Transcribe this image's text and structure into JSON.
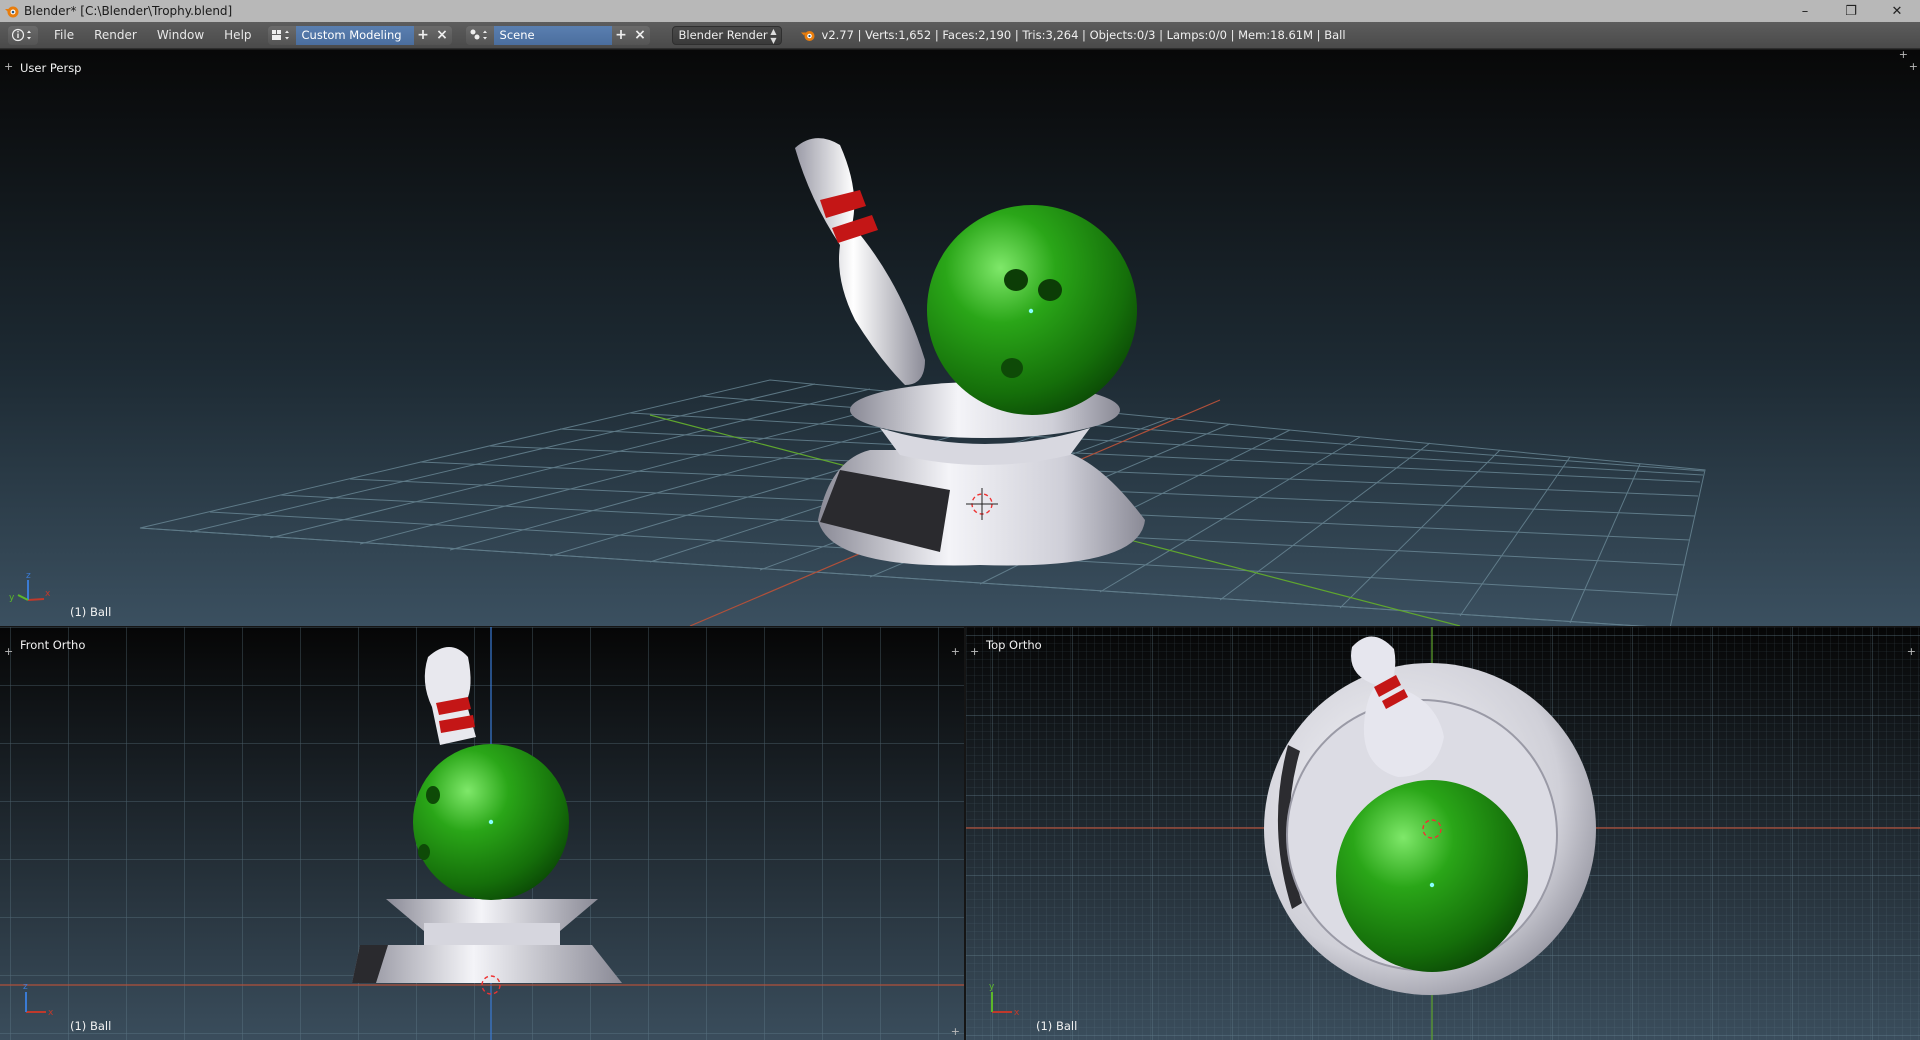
{
  "window": {
    "title": "Blender* [C:\\Blender\\Trophy.blend]",
    "controls": {
      "minimize": "–",
      "restore": "❐",
      "close": "✕"
    }
  },
  "header": {
    "menus": [
      "File",
      "Render",
      "Window",
      "Help"
    ],
    "layout_name": "Custom Modeling",
    "scene_name": "Scene",
    "render_engine": "Blender Render",
    "stats": "v2.77 | Verts:1,652 | Faces:2,190 | Tris:3,264 | Objects:0/3 | Lamps:0/0 | Mem:18.61M | Ball"
  },
  "viewports": {
    "perspective": {
      "label": "User Persp",
      "object": "(1) Ball"
    },
    "front": {
      "label": "Front Ortho",
      "object": "(1) Ball"
    },
    "top": {
      "label": "Top Ortho",
      "object": "(1) Ball"
    }
  },
  "axis_labels": {
    "x": "x",
    "y": "y",
    "z": "z"
  },
  "colors": {
    "ball": "#1e8a12",
    "pin_stripe": "#d01a1a",
    "selection_field": "#5a7fb0",
    "x_axis": "#c0392b",
    "y_axis": "#5cb82a",
    "z_axis": "#3a7bd5"
  }
}
